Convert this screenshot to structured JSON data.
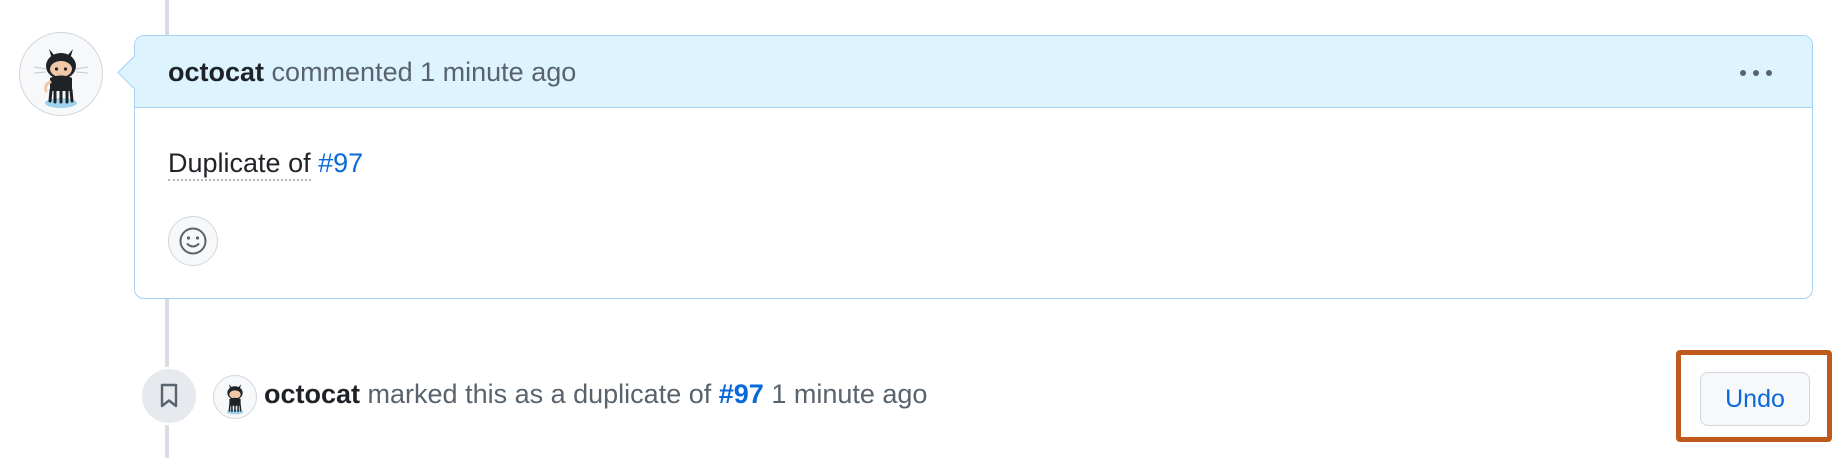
{
  "comment": {
    "author": "octocat",
    "action": "commented",
    "timestamp": "1 minute ago",
    "menu_icon": "kebab-horizontal-icon",
    "body_prefix": "Duplicate of",
    "body_link": "#97",
    "reaction_icon": "smiley-icon"
  },
  "event": {
    "icon": "bookmark-icon",
    "author": "octocat",
    "action": "marked this as a duplicate of",
    "link": "#97",
    "timestamp": "1 minute ago",
    "undo_label": "Undo"
  },
  "colors": {
    "header_bg": "#ddf4ff",
    "header_border": "#a8d2f5",
    "link": "#0969da",
    "highlight": "#c05a1c"
  }
}
